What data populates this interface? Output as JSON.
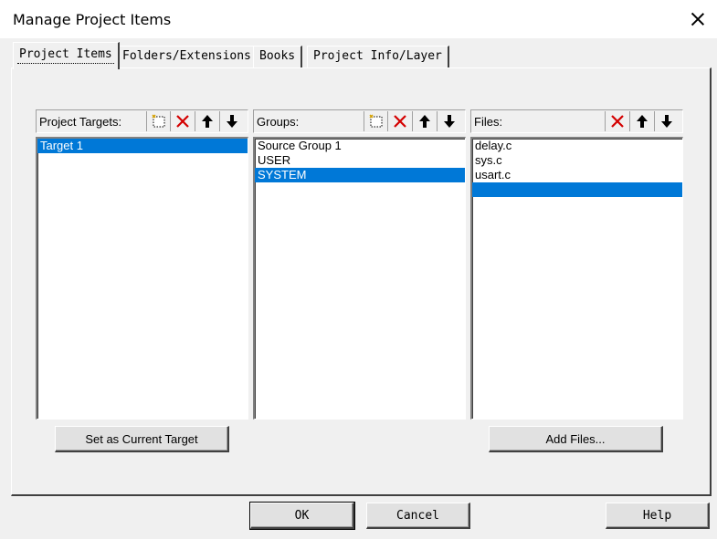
{
  "window": {
    "title": "Manage Project Items"
  },
  "tabs": [
    {
      "label": "Project Items",
      "active": true
    },
    {
      "label": "Folders/Extensions",
      "active": false
    },
    {
      "label": "Books",
      "active": false
    },
    {
      "label": "Project Info/Layer",
      "active": false
    }
  ],
  "targets": {
    "header": "Project Targets:",
    "items": [
      "Target 1"
    ],
    "selected_index": 0,
    "tools": [
      "new-icon",
      "delete-icon",
      "move-up-icon",
      "move-down-icon"
    ],
    "button": "Set as Current Target"
  },
  "groups": {
    "header": "Groups:",
    "items": [
      "Source Group 1",
      "USER",
      "SYSTEM"
    ],
    "selected_index": 2,
    "tools": [
      "new-icon",
      "delete-icon",
      "move-up-icon",
      "move-down-icon"
    ]
  },
  "files": {
    "header": "Files:",
    "items": [
      "delay.c",
      "sys.c",
      "usart.c",
      ""
    ],
    "selected_index": 3,
    "tools": [
      "delete-icon",
      "move-up-icon",
      "move-down-icon"
    ],
    "button": "Add Files..."
  },
  "footer": {
    "ok": "OK",
    "cancel": "Cancel",
    "help": "Help"
  },
  "colors": {
    "selection": "#0078d7",
    "delete_red": "#d40000",
    "dialog_bg": "#f0f0f0"
  }
}
